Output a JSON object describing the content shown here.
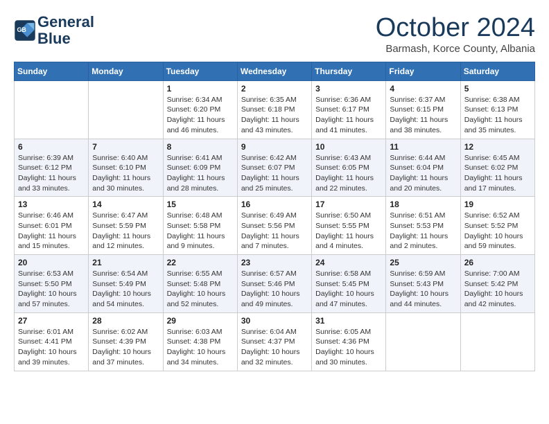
{
  "logo": {
    "line1": "General",
    "line2": "Blue"
  },
  "title": "October 2024",
  "subtitle": "Barmash, Korce County, Albania",
  "headers": [
    "Sunday",
    "Monday",
    "Tuesday",
    "Wednesday",
    "Thursday",
    "Friday",
    "Saturday"
  ],
  "weeks": [
    [
      {
        "day": "",
        "info": ""
      },
      {
        "day": "",
        "info": ""
      },
      {
        "day": "1",
        "info": "Sunrise: 6:34 AM\nSunset: 6:20 PM\nDaylight: 11 hours and 46 minutes."
      },
      {
        "day": "2",
        "info": "Sunrise: 6:35 AM\nSunset: 6:18 PM\nDaylight: 11 hours and 43 minutes."
      },
      {
        "day": "3",
        "info": "Sunrise: 6:36 AM\nSunset: 6:17 PM\nDaylight: 11 hours and 41 minutes."
      },
      {
        "day": "4",
        "info": "Sunrise: 6:37 AM\nSunset: 6:15 PM\nDaylight: 11 hours and 38 minutes."
      },
      {
        "day": "5",
        "info": "Sunrise: 6:38 AM\nSunset: 6:13 PM\nDaylight: 11 hours and 35 minutes."
      }
    ],
    [
      {
        "day": "6",
        "info": "Sunrise: 6:39 AM\nSunset: 6:12 PM\nDaylight: 11 hours and 33 minutes."
      },
      {
        "day": "7",
        "info": "Sunrise: 6:40 AM\nSunset: 6:10 PM\nDaylight: 11 hours and 30 minutes."
      },
      {
        "day": "8",
        "info": "Sunrise: 6:41 AM\nSunset: 6:09 PM\nDaylight: 11 hours and 28 minutes."
      },
      {
        "day": "9",
        "info": "Sunrise: 6:42 AM\nSunset: 6:07 PM\nDaylight: 11 hours and 25 minutes."
      },
      {
        "day": "10",
        "info": "Sunrise: 6:43 AM\nSunset: 6:05 PM\nDaylight: 11 hours and 22 minutes."
      },
      {
        "day": "11",
        "info": "Sunrise: 6:44 AM\nSunset: 6:04 PM\nDaylight: 11 hours and 20 minutes."
      },
      {
        "day": "12",
        "info": "Sunrise: 6:45 AM\nSunset: 6:02 PM\nDaylight: 11 hours and 17 minutes."
      }
    ],
    [
      {
        "day": "13",
        "info": "Sunrise: 6:46 AM\nSunset: 6:01 PM\nDaylight: 11 hours and 15 minutes."
      },
      {
        "day": "14",
        "info": "Sunrise: 6:47 AM\nSunset: 5:59 PM\nDaylight: 11 hours and 12 minutes."
      },
      {
        "day": "15",
        "info": "Sunrise: 6:48 AM\nSunset: 5:58 PM\nDaylight: 11 hours and 9 minutes."
      },
      {
        "day": "16",
        "info": "Sunrise: 6:49 AM\nSunset: 5:56 PM\nDaylight: 11 hours and 7 minutes."
      },
      {
        "day": "17",
        "info": "Sunrise: 6:50 AM\nSunset: 5:55 PM\nDaylight: 11 hours and 4 minutes."
      },
      {
        "day": "18",
        "info": "Sunrise: 6:51 AM\nSunset: 5:53 PM\nDaylight: 11 hours and 2 minutes."
      },
      {
        "day": "19",
        "info": "Sunrise: 6:52 AM\nSunset: 5:52 PM\nDaylight: 10 hours and 59 minutes."
      }
    ],
    [
      {
        "day": "20",
        "info": "Sunrise: 6:53 AM\nSunset: 5:50 PM\nDaylight: 10 hours and 57 minutes."
      },
      {
        "day": "21",
        "info": "Sunrise: 6:54 AM\nSunset: 5:49 PM\nDaylight: 10 hours and 54 minutes."
      },
      {
        "day": "22",
        "info": "Sunrise: 6:55 AM\nSunset: 5:48 PM\nDaylight: 10 hours and 52 minutes."
      },
      {
        "day": "23",
        "info": "Sunrise: 6:57 AM\nSunset: 5:46 PM\nDaylight: 10 hours and 49 minutes."
      },
      {
        "day": "24",
        "info": "Sunrise: 6:58 AM\nSunset: 5:45 PM\nDaylight: 10 hours and 47 minutes."
      },
      {
        "day": "25",
        "info": "Sunrise: 6:59 AM\nSunset: 5:43 PM\nDaylight: 10 hours and 44 minutes."
      },
      {
        "day": "26",
        "info": "Sunrise: 7:00 AM\nSunset: 5:42 PM\nDaylight: 10 hours and 42 minutes."
      }
    ],
    [
      {
        "day": "27",
        "info": "Sunrise: 6:01 AM\nSunset: 4:41 PM\nDaylight: 10 hours and 39 minutes."
      },
      {
        "day": "28",
        "info": "Sunrise: 6:02 AM\nSunset: 4:39 PM\nDaylight: 10 hours and 37 minutes."
      },
      {
        "day": "29",
        "info": "Sunrise: 6:03 AM\nSunset: 4:38 PM\nDaylight: 10 hours and 34 minutes."
      },
      {
        "day": "30",
        "info": "Sunrise: 6:04 AM\nSunset: 4:37 PM\nDaylight: 10 hours and 32 minutes."
      },
      {
        "day": "31",
        "info": "Sunrise: 6:05 AM\nSunset: 4:36 PM\nDaylight: 10 hours and 30 minutes."
      },
      {
        "day": "",
        "info": ""
      },
      {
        "day": "",
        "info": ""
      }
    ]
  ]
}
